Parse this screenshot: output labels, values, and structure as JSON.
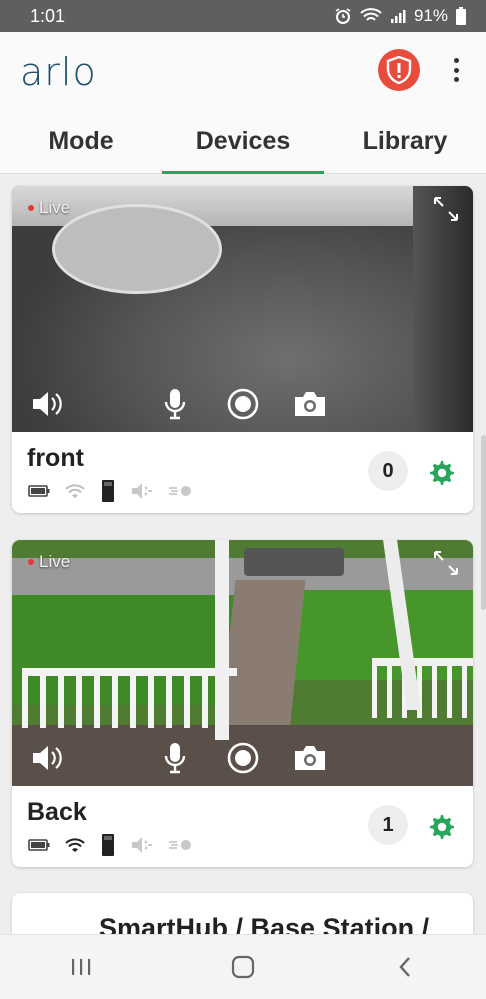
{
  "status_bar": {
    "time": "1:01",
    "battery": "91%"
  },
  "header": {
    "logo": "arlo"
  },
  "tabs": [
    {
      "label": "Mode"
    },
    {
      "label": "Devices",
      "active": true
    },
    {
      "label": "Library"
    }
  ],
  "cameras": [
    {
      "name": "front",
      "live_label": "Live",
      "count": "0"
    },
    {
      "name": "Back",
      "live_label": "Live",
      "count": "1"
    }
  ],
  "hub": {
    "title": "SmartHub / Base Station /"
  },
  "colors": {
    "accent": "#26a65b",
    "brand": "#1d4f6b",
    "alert": "#e74c3c"
  }
}
